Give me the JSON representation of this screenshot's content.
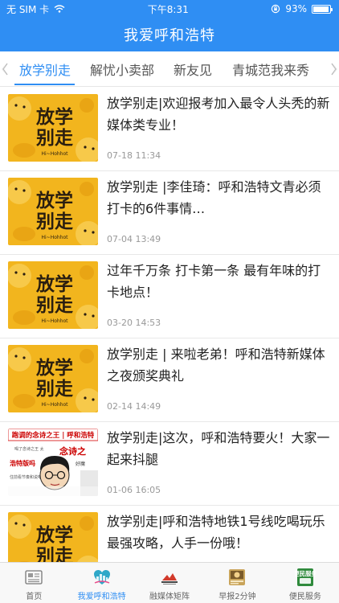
{
  "status_bar": {
    "carrier": "无 SIM 卡",
    "time": "下午8:31",
    "battery_percent": "93%",
    "battery_level": 0.93
  },
  "nav": {
    "title": "我爱呼和浩特"
  },
  "tabs": [
    {
      "label": "放学别走",
      "active": true
    },
    {
      "label": "解忧小卖部",
      "active": false
    },
    {
      "label": "新友见",
      "active": false
    },
    {
      "label": "青城范我来秀",
      "active": false
    }
  ],
  "articles": [
    {
      "title": "放学别走|欢迎报考加入最令人头秃的新媒体类专业！",
      "date": "07-18 11:34",
      "thumb": "poster-icon"
    },
    {
      "title": "放学别走 |李佳琦：呼和浩特文青必须打卡的6件事情…",
      "date": "07-04 13:49",
      "thumb": "poster-icon"
    },
    {
      "title": "过年千万条 打卡第一条 最有年味的打卡地点！",
      "date": "03-20 14:53",
      "thumb": "poster-icon"
    },
    {
      "title": "放学别走 | 来啦老弟！呼和浩特新媒体之夜颁奖典礼",
      "date": "02-14 14:49",
      "thumb": "poster-icon"
    },
    {
      "title": "放学别走|这次，呼和浩特要火！大家一起来抖腿",
      "date": "01-06 16:05",
      "thumb": "poem-king-icon",
      "thumb_text": {
        "banner": "跑调的念诗之王 | 呼和浩特",
        "caption": "念诗之",
        "side": "浩特版吗",
        "small1": "喝了念诗之王 太",
        "small2": "好魔",
        "small3": "住前看节奏和说唱"
      }
    },
    {
      "title": "放学别走|呼和浩特地铁1号线吃喝玩乐最强攻略，人手一份哦！",
      "date": "",
      "thumb": "poster-icon"
    }
  ],
  "poster": {
    "line1": "放学",
    "line2": "别走",
    "sub": "Hi~Hohhot"
  },
  "tabbar": [
    {
      "label": "首页",
      "icon": "newspaper-icon",
      "active": false
    },
    {
      "label": "我爱呼和浩特",
      "active": true,
      "icon": "heart-city-icon"
    },
    {
      "label": "融媒体矩阵",
      "active": false,
      "icon": "media-logo-icon"
    },
    {
      "label": "早报2分钟",
      "active": false,
      "icon": "morning-news-icon"
    },
    {
      "label": "便民服务",
      "active": false,
      "icon": "service-icon",
      "icon_text": "便民服务"
    }
  ],
  "colors": {
    "accent": "#2f8ef3",
    "poster_yellow": "#f2b51e",
    "poster_dark": "#2a1e10"
  }
}
